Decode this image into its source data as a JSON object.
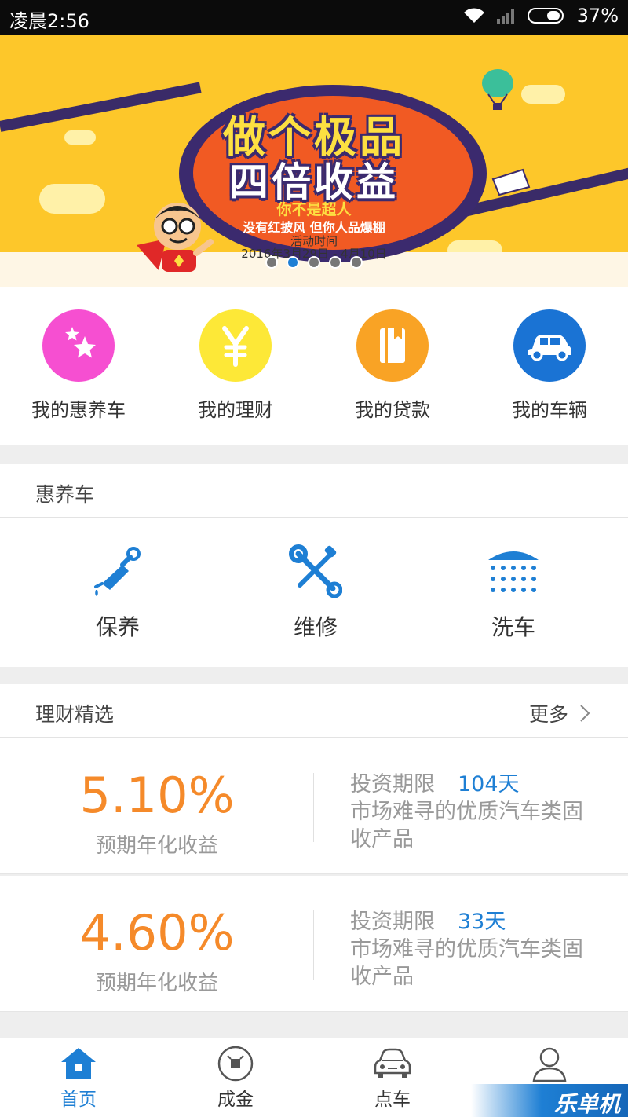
{
  "status_bar": {
    "time": "凌晨2:56",
    "battery": "37%"
  },
  "banner": {
    "headline_1": "做个极品",
    "headline_2": "四倍收益",
    "subtitle_1": "你不是超人",
    "subtitle_2": "没有红披风 但你人品爆棚",
    "activity_label": "活动时间",
    "activity_date": "2016年3月29日 - 4月10日",
    "page_count": 5,
    "active_page": 2
  },
  "quick_menu": [
    {
      "label": "我的惠养车",
      "icon": "stars-icon",
      "color": "#f64fd1"
    },
    {
      "label": "我的理财",
      "icon": "yen-icon",
      "color": "#fde837"
    },
    {
      "label": "我的贷款",
      "icon": "book-icon",
      "color": "#f9a325"
    },
    {
      "label": "我的车辆",
      "icon": "car-icon",
      "color": "#1a73d4"
    }
  ],
  "service_section": {
    "title": "惠养车",
    "items": [
      {
        "label": "保养",
        "icon": "oil-can-icon"
      },
      {
        "label": "维修",
        "icon": "wrench-screwdriver-icon"
      },
      {
        "label": "洗车",
        "icon": "shower-icon"
      }
    ]
  },
  "finance_section": {
    "title": "理财精选",
    "more_label": "更多"
  },
  "products": [
    {
      "rate": "5.10%",
      "rate_label": "预期年化收益",
      "term_label": "投资期限",
      "term_value": "104天",
      "description": "市场难寻的优质汽车类固收产品"
    },
    {
      "rate": "4.60%",
      "rate_label": "预期年化收益",
      "term_label": "投资期限",
      "term_value": "33天",
      "description": "市场难寻的优质汽车类固收产品"
    }
  ],
  "tab_bar": [
    {
      "label": "首页",
      "icon": "home-icon",
      "active": true
    },
    {
      "label": "成金",
      "icon": "coin-icon",
      "active": false
    },
    {
      "label": "点车",
      "icon": "car-front-icon",
      "active": false
    },
    {
      "label": "我",
      "icon": "person-icon",
      "active": false
    }
  ],
  "watermark": "乐单机",
  "colors": {
    "accent": "#1e7fd4",
    "rate": "#f58a2a",
    "banner_bg": "#fdc72a"
  }
}
